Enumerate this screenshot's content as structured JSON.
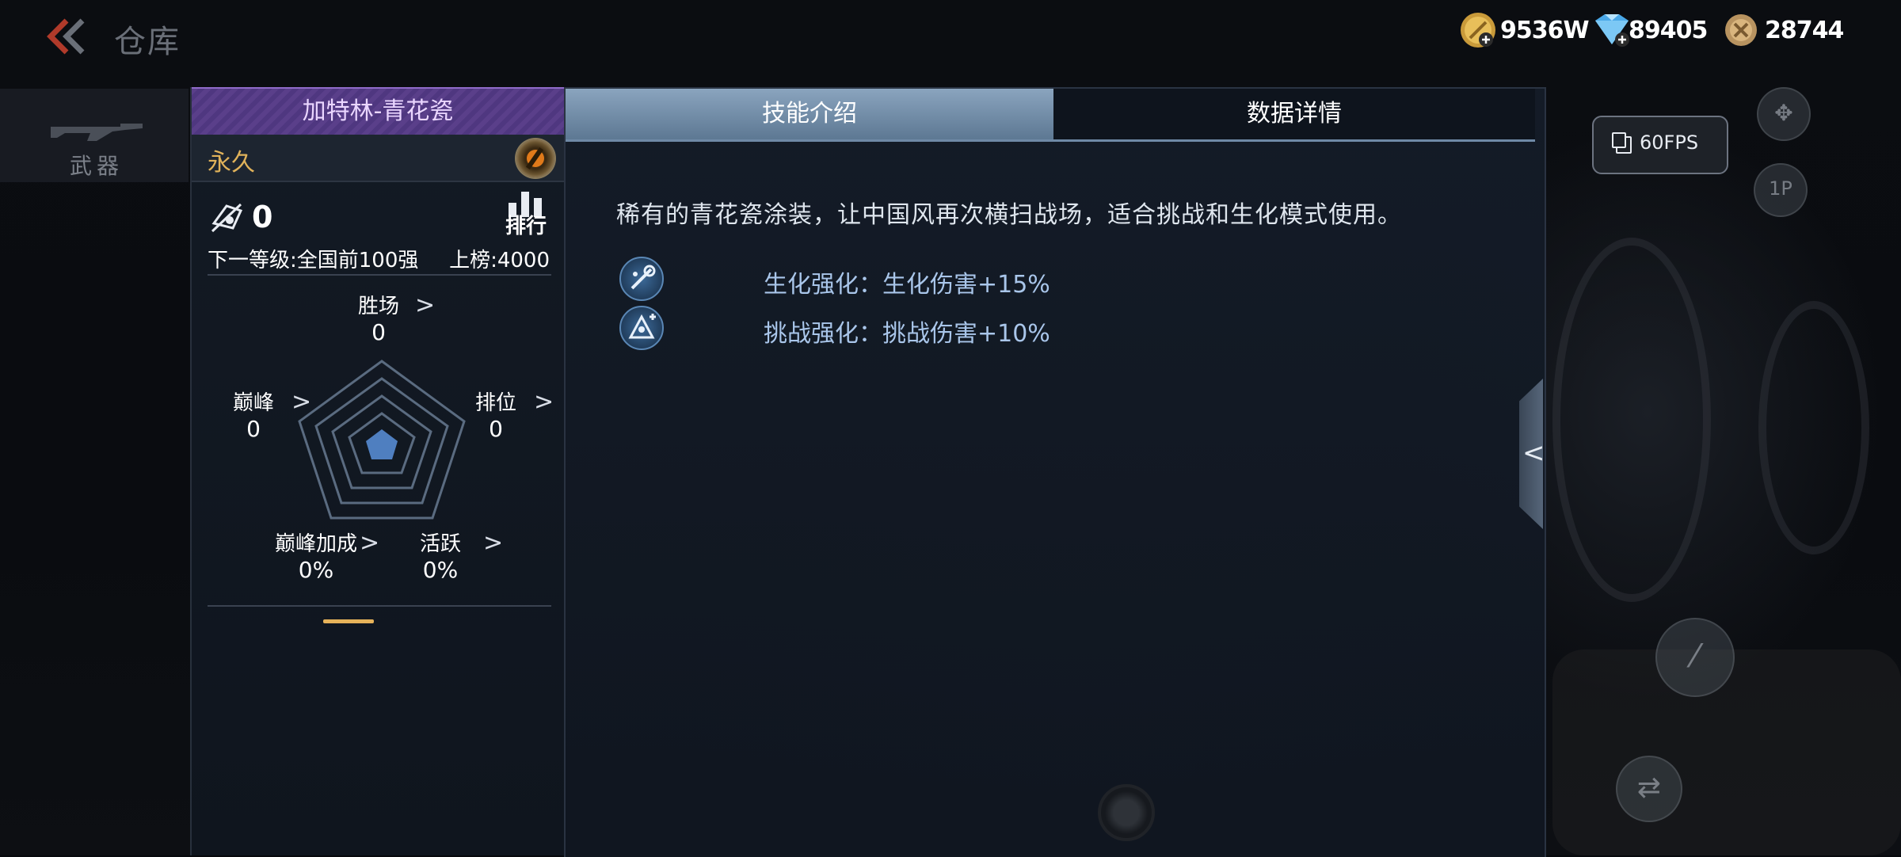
{
  "header": {
    "title": "仓库",
    "currencies": [
      {
        "icon": "gold-coin-icon",
        "value": "9536W"
      },
      {
        "icon": "diamond-icon",
        "value": "89405"
      },
      {
        "icon": "honor-coin-icon",
        "value": "28744"
      }
    ]
  },
  "category": {
    "label": "武器",
    "icon": "rifle-icon"
  },
  "item": {
    "name": "加特林-青花瓷",
    "duration": "永久",
    "ranking_count": "0",
    "rank_button_label": "排行",
    "next_level": "下一等级:全国前100强",
    "leaderboard_score": "上榜:4000",
    "stats": {
      "wins": {
        "label": "胜场",
        "value": "0"
      },
      "peak": {
        "label": "巅峰",
        "value": "0"
      },
      "ranked": {
        "label": "排位",
        "value": "0"
      },
      "peak_bonus": {
        "label": "巅峰加成",
        "value": "0%"
      },
      "activity": {
        "label": "活跃",
        "value": "0%"
      }
    }
  },
  "tabs": {
    "skill": "技能介绍",
    "data": "数据详情",
    "active": "skill"
  },
  "skill_intro": {
    "description": "稀有的青花瓷涂装，让中国风再次横扫战场，适合挑战和生化模式使用。",
    "skills": [
      {
        "icon": "zombie-boost-icon",
        "text": "生化强化：生化伤害+15%"
      },
      {
        "icon": "challenge-boost-icon",
        "text": "挑战强化：挑战伤害+10%"
      }
    ]
  },
  "overlay": {
    "fps_label": "60FPS"
  },
  "colors": {
    "title_purple": "#5a3f8a",
    "duration_gold": "#e0b25a",
    "skill_text_blue": "#a9c6ea",
    "tab_active": "#8aa4be",
    "radar_fill": "#4f7fc0"
  }
}
